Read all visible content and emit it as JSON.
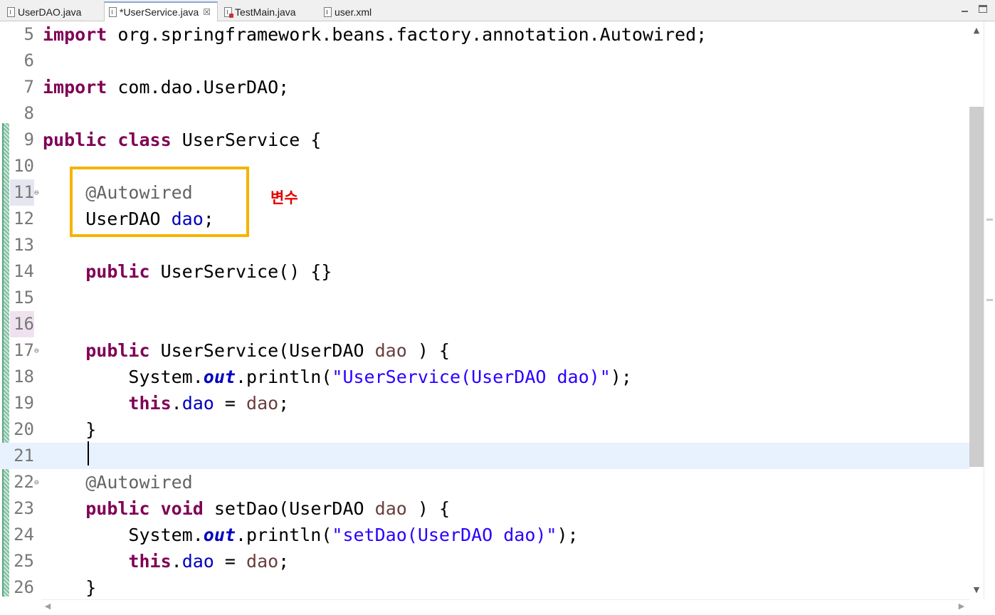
{
  "tabs": [
    {
      "label": "UserDAO.java",
      "icon": "java-file-icon",
      "active": false
    },
    {
      "label": "*UserService.java",
      "icon": "java-file-icon",
      "active": true,
      "close": "☒"
    },
    {
      "label": "TestMain.java",
      "icon": "java-test-file-icon",
      "active": false
    },
    {
      "label": "user.xml",
      "icon": "xml-file-icon",
      "active": false
    }
  ],
  "lines": [
    {
      "n": "5",
      "tokens": [
        [
          "kw",
          "import"
        ],
        [
          "",
          "org.springframework.beans.factory.annotation.Autowired;"
        ]
      ]
    },
    {
      "n": "6",
      "tokens": []
    },
    {
      "n": "7",
      "tokens": [
        [
          "kw",
          "import"
        ],
        [
          "",
          "com.dao.UserDAO;"
        ]
      ]
    },
    {
      "n": "8",
      "tokens": []
    },
    {
      "n": "9",
      "tokens": [
        [
          "kw",
          "public"
        ],
        [
          "",
          " "
        ],
        [
          "kw",
          "class"
        ],
        [
          "",
          " UserService {"
        ]
      ]
    },
    {
      "n": "10",
      "tokens": []
    },
    {
      "n": "11",
      "tokens": [
        [
          "",
          "    "
        ],
        [
          "ann",
          "@Autowired"
        ]
      ],
      "fold": true,
      "mark": "mark"
    },
    {
      "n": "12",
      "tokens": [
        [
          "",
          "    UserDAO "
        ],
        [
          "fld",
          "dao"
        ],
        [
          "",
          ";"
        ]
      ]
    },
    {
      "n": "13",
      "tokens": []
    },
    {
      "n": "14",
      "tokens": [
        [
          "",
          "    "
        ],
        [
          "kw",
          "public"
        ],
        [
          "",
          " UserService() {}"
        ]
      ]
    },
    {
      "n": "15",
      "tokens": []
    },
    {
      "n": "16",
      "tokens": [],
      "mark": "mark2"
    },
    {
      "n": "17",
      "tokens": [
        [
          "",
          "    "
        ],
        [
          "kw",
          "public"
        ],
        [
          "",
          " UserService(UserDAO "
        ],
        [
          "par",
          "dao"
        ],
        [
          "",
          " ) {"
        ]
      ],
      "fold": true
    },
    {
      "n": "18",
      "tokens": [
        [
          "",
          "        System."
        ],
        [
          "sfld",
          "out"
        ],
        [
          "",
          ".println("
        ],
        [
          "str",
          "\"UserService(UserDAO dao)\""
        ],
        [
          "",
          ");"
        ]
      ]
    },
    {
      "n": "19",
      "tokens": [
        [
          "",
          "        "
        ],
        [
          "kw",
          "this"
        ],
        [
          "",
          "."
        ],
        [
          "fld",
          "dao"
        ],
        [
          "",
          " = "
        ],
        [
          "par",
          "dao"
        ],
        [
          "",
          ";"
        ]
      ]
    },
    {
      "n": "20",
      "tokens": [
        [
          "",
          "    }"
        ]
      ]
    },
    {
      "n": "21",
      "tokens": [],
      "current": true
    },
    {
      "n": "22",
      "tokens": [
        [
          "",
          "    "
        ],
        [
          "ann",
          "@Autowired"
        ]
      ],
      "fold": true
    },
    {
      "n": "23",
      "tokens": [
        [
          "",
          "    "
        ],
        [
          "kw",
          "public"
        ],
        [
          "",
          " "
        ],
        [
          "kw",
          "void"
        ],
        [
          "",
          " setDao(UserDAO "
        ],
        [
          "par",
          "dao"
        ],
        [
          "",
          " ) {"
        ]
      ]
    },
    {
      "n": "24",
      "tokens": [
        [
          "",
          "        System."
        ],
        [
          "sfld",
          "out"
        ],
        [
          "",
          ".println("
        ],
        [
          "str",
          "\"setDao(UserDAO dao)\""
        ],
        [
          "",
          ");"
        ]
      ]
    },
    {
      "n": "25",
      "tokens": [
        [
          "",
          "        "
        ],
        [
          "kw",
          "this"
        ],
        [
          "",
          "."
        ],
        [
          "fld",
          "dao"
        ],
        [
          "",
          " = "
        ],
        [
          "par",
          "dao"
        ],
        [
          "",
          ";"
        ]
      ]
    },
    {
      "n": "26",
      "tokens": [
        [
          "",
          "    }"
        ]
      ]
    }
  ],
  "annotation": {
    "note": "변수",
    "color": "#e60000",
    "box_color": "#f5b400"
  },
  "scroll": {
    "up": "▲",
    "down": "▼",
    "left": "◀",
    "right": "▶"
  }
}
